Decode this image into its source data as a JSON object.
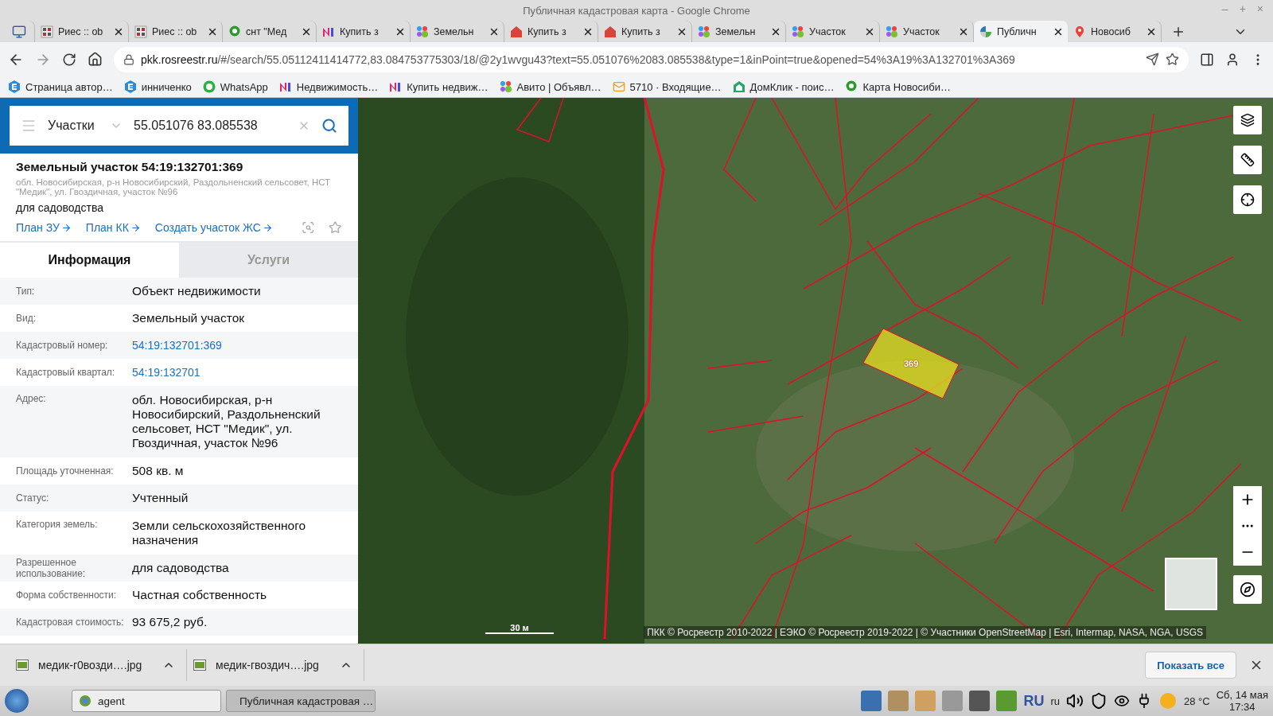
{
  "window": {
    "title": "Публичная кадастровая карта - Google Chrome",
    "controls": [
      "–",
      "+",
      "×"
    ]
  },
  "tabs": [
    {
      "selected": false
    },
    {
      "label": "Риес :: ob",
      "selected": false
    },
    {
      "label": "Риес :: ob",
      "selected": false
    },
    {
      "label": "снт \"Мед",
      "selected": false
    },
    {
      "label": "Купить з",
      "selected": false
    },
    {
      "label": "Земельн",
      "selected": false
    },
    {
      "label": "Купить з",
      "selected": false
    },
    {
      "label": "Купить з",
      "selected": false
    },
    {
      "label": "Земельн",
      "selected": false
    },
    {
      "label": "Участок",
      "selected": false
    },
    {
      "label": "Участок",
      "selected": false
    },
    {
      "label": "Публичн",
      "selected": true
    },
    {
      "label": "Новосиб",
      "selected": false
    }
  ],
  "address_bar": {
    "host": "pkk.rosreestr.ru",
    "path": "/#/search/55.05112411414772,83.084753775303/18/@2y1wvgu43?text=55.051076%2083.085538&type=1&inPoint=true&opened=54%3A19%3A132701%3A369"
  },
  "bookmarks": [
    "Страница автор…",
    "инниченко",
    "WhatsApp",
    "Недвижимость…",
    "Купить недвиж…",
    "Авито | Объявл…",
    "5710 · Входящие…",
    "ДомКлик - поис…",
    "Карта Новосиби…"
  ],
  "search": {
    "category": "Участки",
    "value": "55.051076 83.085538"
  },
  "parcel": {
    "title": "Земельный участок 54:19:132701:369",
    "address": "обл. Новосибирская, р-н Новосибирский, Раздольненский сельсовет, НСТ \"Медик\", ул. Гвоздичная, участок №96",
    "purpose": "для садоводства",
    "links": [
      "План ЗУ",
      "План КК",
      "Создать участок ЖС"
    ]
  },
  "panel_tabs": [
    {
      "label": "Информация",
      "selected": true
    },
    {
      "label": "Услуги",
      "selected": false
    }
  ],
  "info_rows": [
    {
      "label": "Тип:",
      "value": "Объект недвижимости",
      "kind": "text"
    },
    {
      "label": "Вид:",
      "value": "Земельный участок",
      "kind": "text"
    },
    {
      "label": "Кадастровый номер:",
      "value": "54:19:132701:369",
      "kind": "link"
    },
    {
      "label": "Кадастровый квартал:",
      "value": "54:19:132701",
      "kind": "link"
    },
    {
      "label": "Адрес:",
      "value": "обл. Новосибирская, р-н Новосибирский, Раздольненский сельсовет, НСТ \"Медик\", ул. Гвоздичная, участок №96",
      "kind": "text"
    },
    {
      "label": "Площадь уточненная:",
      "value": "508 кв. м",
      "kind": "text"
    },
    {
      "label": "Статус:",
      "value": "Учтенный",
      "kind": "text"
    },
    {
      "label": "Категория земель:",
      "value": "Земли сельскохозяйственного назначения",
      "kind": "text"
    },
    {
      "label": "Разрешенное использование:",
      "value": "для садоводства",
      "kind": "text"
    },
    {
      "label": "Форма собственности:",
      "value": "Частная собственность",
      "kind": "text"
    },
    {
      "label": "Кадастровая стоимость:",
      "value": "93 675,2 руб.",
      "kind": "text"
    }
  ],
  "map": {
    "selected_parcel": "369",
    "scale": "30 м",
    "attribution": "ПКК © Росреестр 2010-2022 | ЕЭКО © Росреестр 2019-2022 | © Участники OpenStreetMap | Esri, Intermap, NASA, NGA, USGS"
  },
  "downloads": {
    "files": [
      "медик-г0возди….jpg",
      "медик-гвоздич….jpg"
    ],
    "show_all": "Показать все"
  },
  "taskbar": {
    "windows": [
      {
        "label": "agent",
        "selected": false
      },
      {
        "label": "Публичная кадастровая …",
        "selected": true
      }
    ],
    "keyboard": "RU",
    "locale": "ru",
    "temperature": "28 °C",
    "date": "Сб, 14 мая",
    "time": "17:34"
  }
}
